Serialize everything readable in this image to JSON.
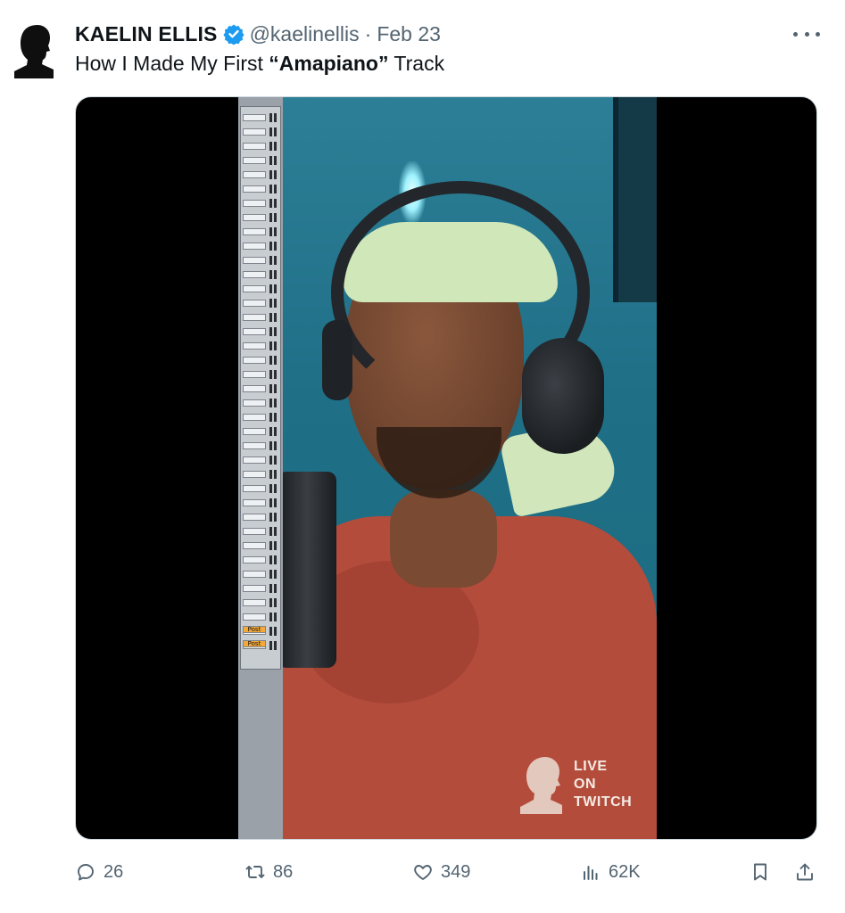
{
  "tweet": {
    "author_name": "KAELIN ELLIS",
    "handle": "@kaelinellis",
    "separator": "·",
    "date": "Feb 23",
    "text_before": "How I Made My First ",
    "text_bold": "“Amapiano”",
    "text_after": " Track"
  },
  "media": {
    "overlay_line1": "LIVE",
    "overlay_line2": "ON",
    "overlay_line3": "TWITCH",
    "daw_labels": [
      "Post",
      "Post"
    ]
  },
  "actions": {
    "replies": "26",
    "retweets": "86",
    "likes": "349",
    "views": "62K"
  },
  "colors": {
    "verified": "#1d9bf0",
    "muted_text": "#536471",
    "hoodie": "#b44c3c"
  },
  "icons": [
    "more-icon",
    "verified-badge-icon",
    "reply-icon",
    "retweet-icon",
    "like-icon",
    "views-icon",
    "bookmark-icon",
    "share-icon"
  ]
}
